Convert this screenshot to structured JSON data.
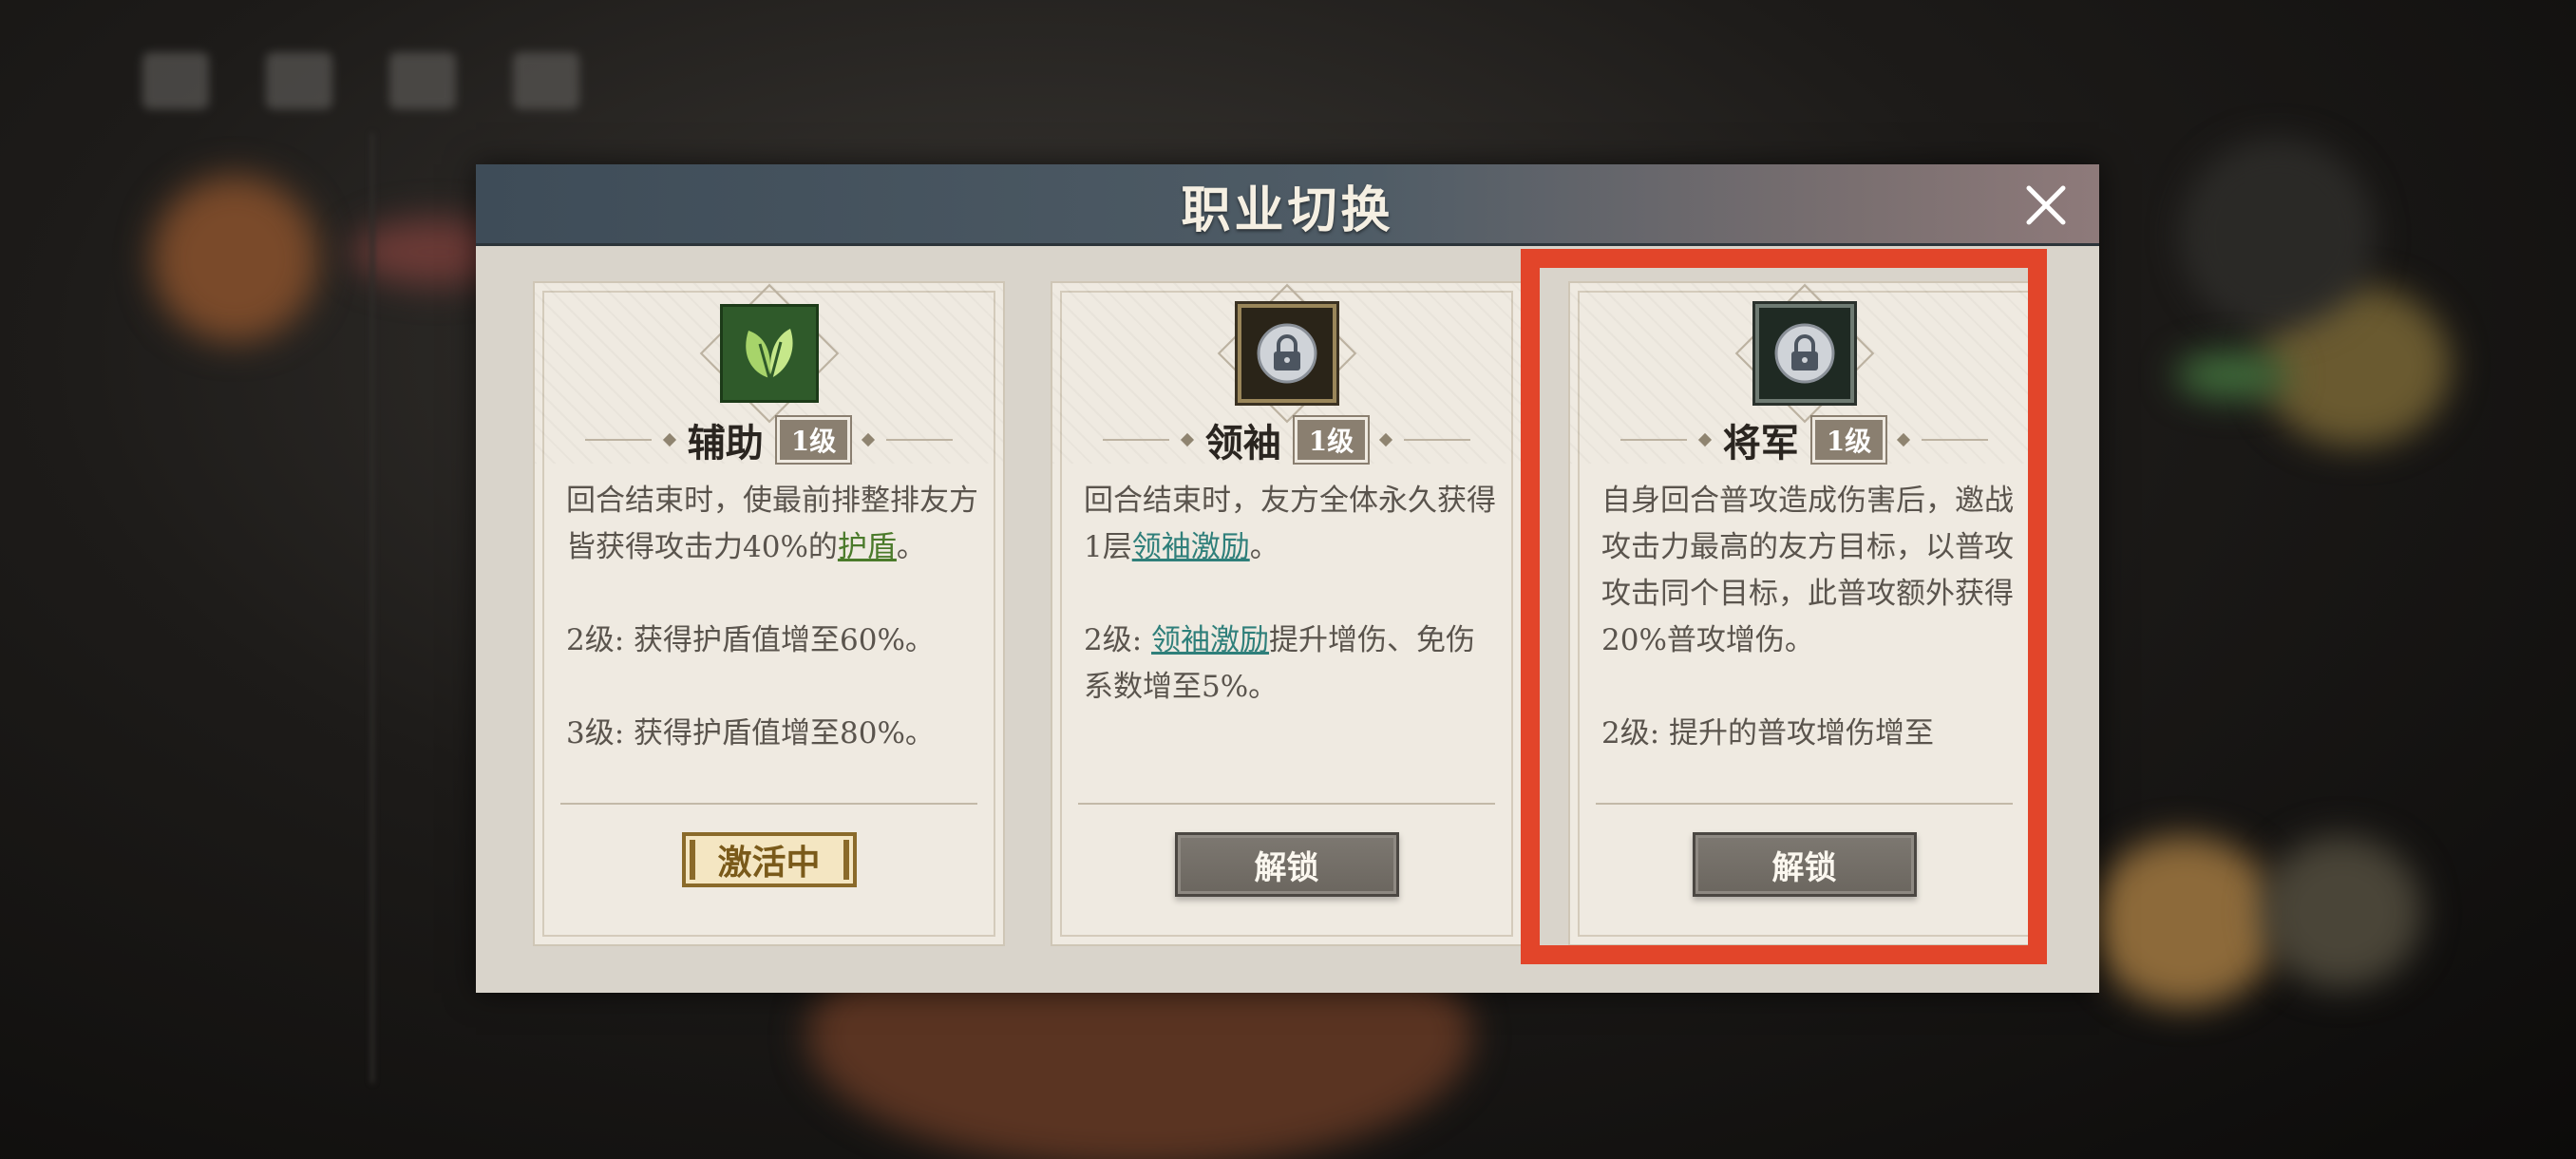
{
  "dialog": {
    "title": "职业切换",
    "close_icon": "close-icon"
  },
  "cards": [
    {
      "icon": "leaf-icon",
      "name": "辅助",
      "level": "1级",
      "desc_line1": "回合结束时，使最前排整排友方皆获得攻击力40%的",
      "keyword": "护盾",
      "desc_end": "。",
      "level2": "2级: 获得护盾值增至60%。",
      "level3": "3级: 获得护盾值增至80%。",
      "status": "激活中"
    },
    {
      "icon": "lock-icon",
      "name": "领袖",
      "level": "1级",
      "desc_line1": "回合结束时，友方全体永久获得1层",
      "keyword": "领袖激励",
      "desc_end": "。",
      "level2_prefix": "2级: ",
      "level2_keyword": "领袖激励",
      "level2_suffix": "提升增伤、免伤系数增至5%。",
      "button": "解锁"
    },
    {
      "icon": "lock-icon",
      "name": "将军",
      "level": "1级",
      "desc": "自身回合普攻造成伤害后，邀战攻击力最高的友方目标，以普攻攻击同个目标，此普攻额外获得20%普攻增伤。",
      "level2": "2级: 提升的普攻增伤增至",
      "button": "解锁"
    }
  ],
  "colors": {
    "highlight": "#e2452a",
    "header_start": "#3e4c58",
    "header_end": "#8e7a7a"
  }
}
